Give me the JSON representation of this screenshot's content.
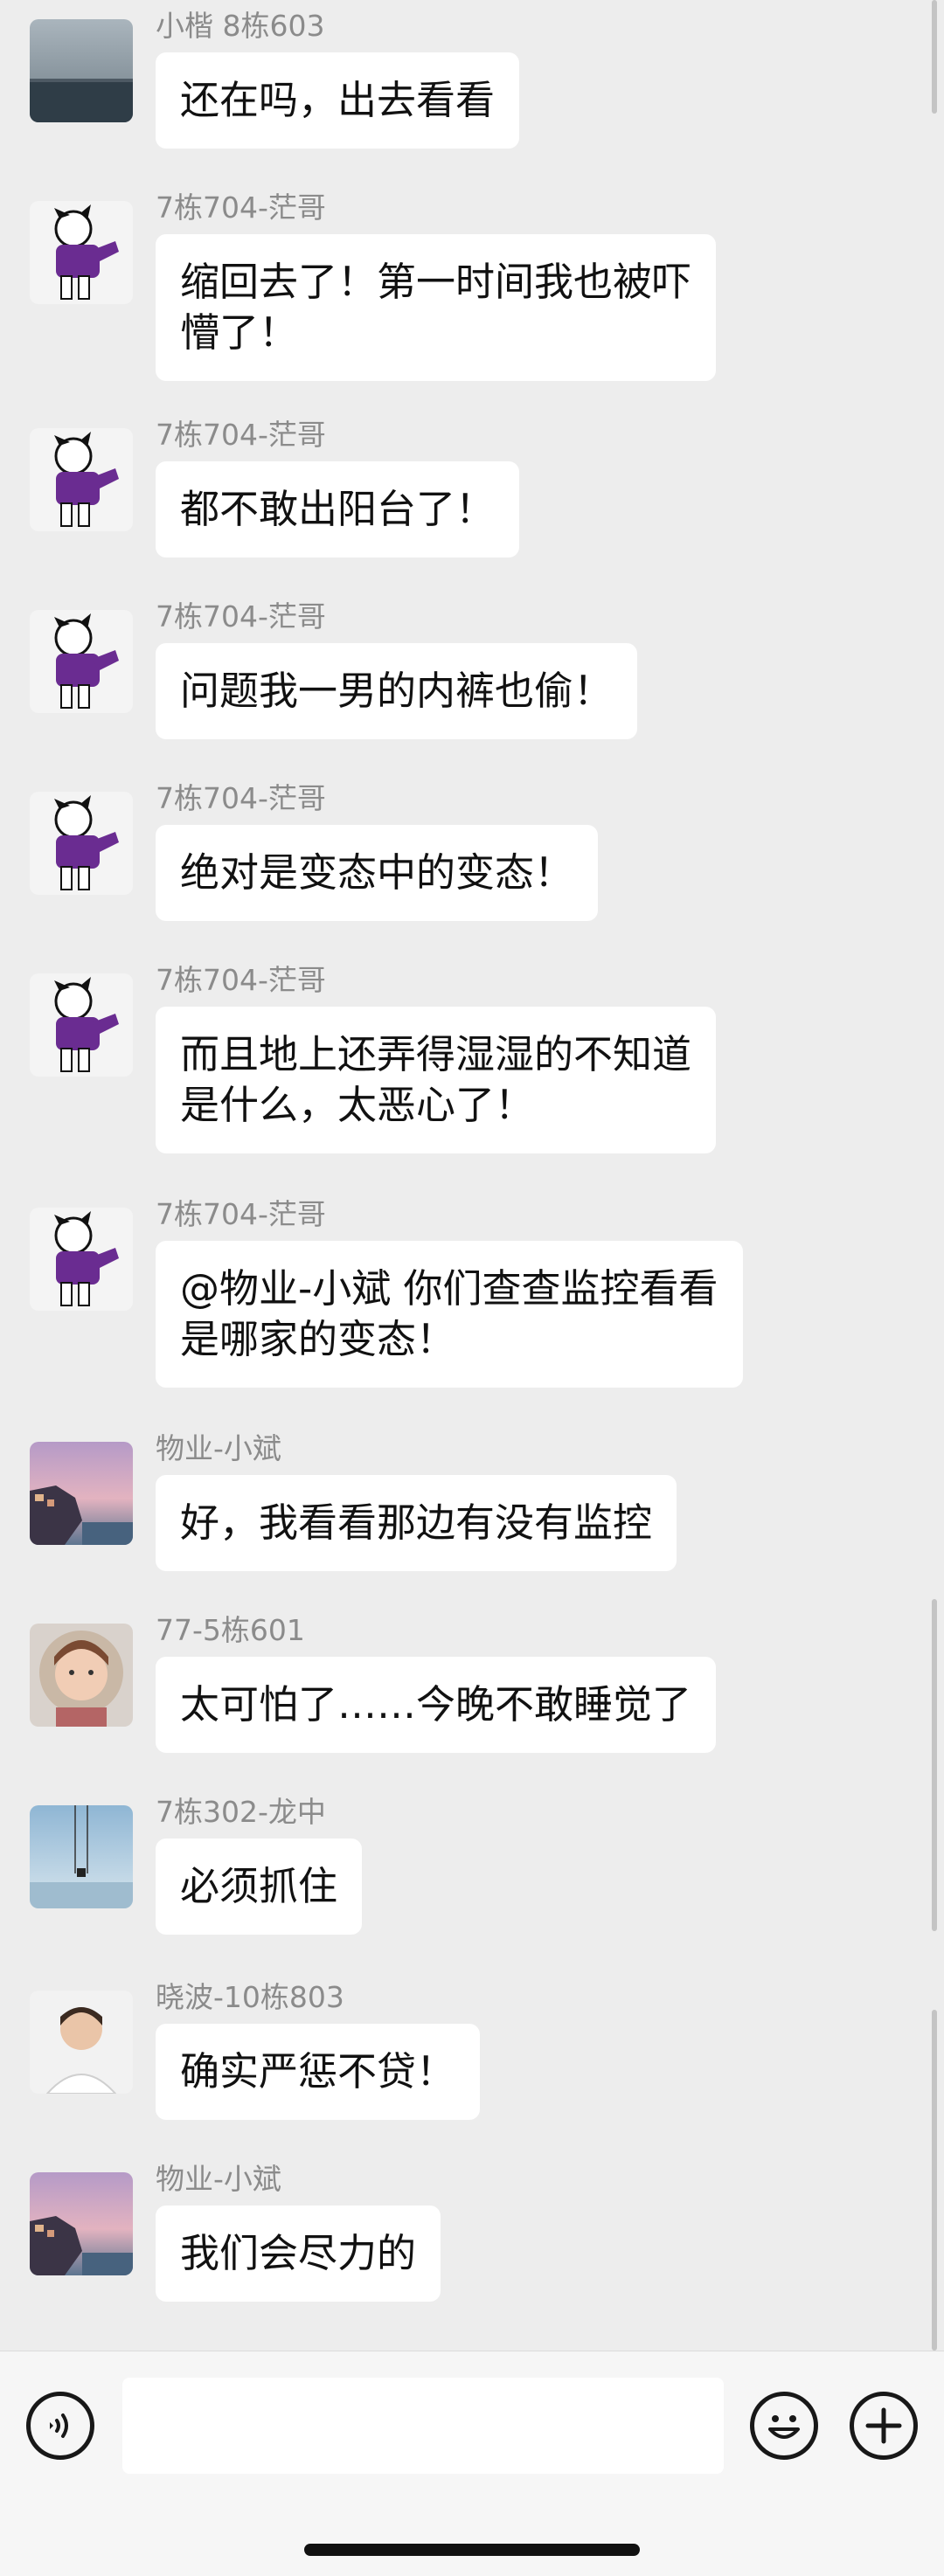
{
  "messages": [
    {
      "sender": "小楷 8栋603",
      "avatar": "sea-landscape",
      "lines": [
        "还在吗，出去看看"
      ]
    },
    {
      "sender": "7栋704-茫哥",
      "avatar": "cartoon-purple-shirt",
      "lines": [
        "缩回去了！第一时间我也被吓",
        "懵了！"
      ]
    },
    {
      "sender": "7栋704-茫哥",
      "avatar": "cartoon-purple-shirt",
      "lines": [
        "都不敢出阳台了！"
      ]
    },
    {
      "sender": "7栋704-茫哥",
      "avatar": "cartoon-purple-shirt",
      "lines": [
        "问题我一男的内裤也偷！"
      ]
    },
    {
      "sender": "7栋704-茫哥",
      "avatar": "cartoon-purple-shirt",
      "lines": [
        "绝对是变态中的变态！"
      ]
    },
    {
      "sender": "7栋704-茫哥",
      "avatar": "cartoon-purple-shirt",
      "lines": [
        "而且地上还弄得湿湿的不知道",
        "是什么，太恶心了！"
      ]
    },
    {
      "sender": "7栋704-茫哥",
      "avatar": "cartoon-purple-shirt",
      "lines": [
        "@物业-小斌 你们查查监控看看",
        "是哪家的变态！"
      ]
    },
    {
      "sender": "物业-小斌",
      "avatar": "coastal-town-sunset",
      "lines": [
        "好，我看看那边有没有监控"
      ]
    },
    {
      "sender": "77-5栋601",
      "avatar": "woman-fur-hood",
      "lines": [
        "太可怕了……今晚不敢睡觉了"
      ]
    },
    {
      "sender": "7栋302-龙中",
      "avatar": "swing-sky",
      "lines": [
        "必须抓住"
      ]
    },
    {
      "sender": "晓波-10栋803",
      "avatar": "man-portrait",
      "lines": [
        "确实严惩不贷！"
      ]
    },
    {
      "sender": "物业-小斌",
      "avatar": "coastal-town-sunset",
      "lines": [
        "我们会尽力的"
      ]
    }
  ],
  "input_bar": {
    "voice_icon": "voice-icon",
    "emoji_icon": "emoji-icon",
    "plus_icon": "plus-icon",
    "input_value": ""
  },
  "colors": {
    "chat_background": "#ededed",
    "bubble": "#ffffff",
    "sender_text": "#8b8b8b",
    "message_text": "#111111"
  }
}
